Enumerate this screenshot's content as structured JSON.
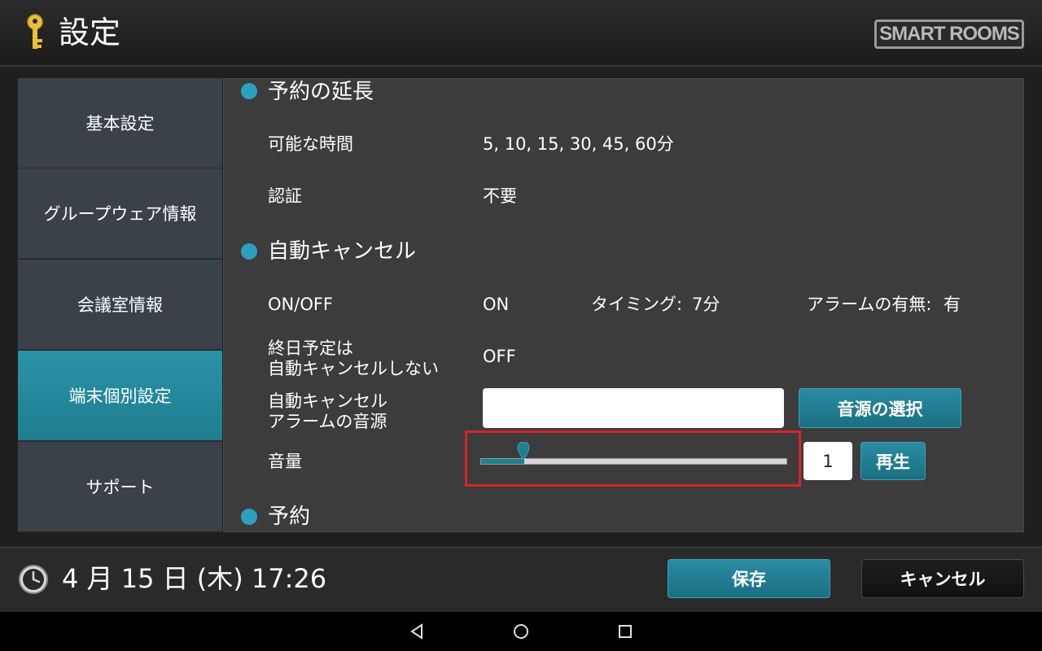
{
  "header": {
    "title": "設定",
    "brand": "SMART ROOMS",
    "key_icon": "key-icon"
  },
  "sidebar": {
    "items": [
      {
        "label": "基本設定",
        "active": false
      },
      {
        "label": "グループウェア情報",
        "active": false
      },
      {
        "label": "会議室情報",
        "active": false
      },
      {
        "label": "端末個別設定",
        "active": true
      },
      {
        "label": "サポート",
        "active": false
      }
    ]
  },
  "content": {
    "extension": {
      "title": "予約の延長",
      "possible_time_label": "可能な時間",
      "possible_time_value": "5, 10, 15, 30, 45, 60分",
      "auth_label": "認証",
      "auth_value": "不要"
    },
    "auto_cancel": {
      "title": "自動キャンセル",
      "onoff_label": "ON/OFF",
      "onoff_value": "ON",
      "timing_label": "タイミング:",
      "timing_value": "7分",
      "alarm_label": "アラームの有無:",
      "alarm_value": "有",
      "allday_label_line1": "終日予定は",
      "allday_label_line2": "自動キャンセルしない",
      "allday_value": "OFF",
      "sound_label_line1": "自動キャンセル",
      "sound_label_line2": "アラームの音源",
      "sound_value": "",
      "sound_select_button": "音源の選択",
      "volume_label": "音量",
      "volume_value": "1",
      "volume_fraction": 0.14,
      "play_button": "再生"
    },
    "reservation": {
      "title": "予約"
    }
  },
  "footer": {
    "datetime": "4 月 15 日 (木) 17:26",
    "clock_icon": "clock-icon",
    "save_button": "保存",
    "cancel_button": "キャンセル"
  },
  "navbar": {
    "back_icon": "back-triangle-icon",
    "home_icon": "home-circle-icon",
    "recents_icon": "recents-square-icon"
  },
  "colors": {
    "accent": "#1f7e90",
    "dot": "#2a9fc0",
    "highlight": "#d9242a"
  }
}
